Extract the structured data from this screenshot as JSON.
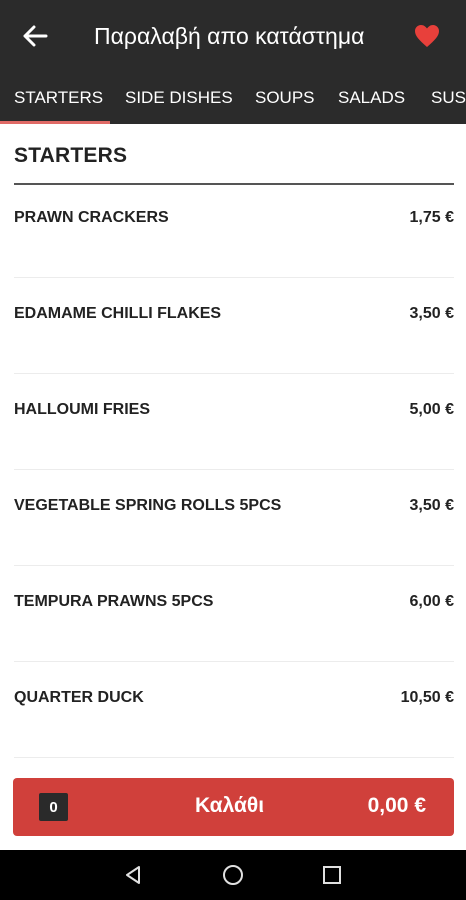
{
  "header": {
    "title": "Παραλαβή απο κατάστημα",
    "back_icon": "back-arrow-icon",
    "favorite_icon": "heart-icon",
    "favorite_color": "#e8403b"
  },
  "tabs": [
    {
      "label": "STARTERS",
      "active": true
    },
    {
      "label": "SIDE DISHES",
      "active": false
    },
    {
      "label": "SOUPS",
      "active": false
    },
    {
      "label": "SALADS",
      "active": false
    },
    {
      "label": "SUSHI",
      "active": false
    }
  ],
  "section": {
    "title": "STARTERS",
    "items": [
      {
        "name": "PRAWN CRACKERS",
        "price": "1,75 €"
      },
      {
        "name": "EDAMAME CHILLI FLAKES",
        "price": "3,50 €"
      },
      {
        "name": "HALLOUMI FRIES",
        "price": "5,00 €"
      },
      {
        "name": "VEGETABLE SPRING ROLLS 5PCS",
        "price": "3,50 €"
      },
      {
        "name": "TEMPURA PRAWNS 5PCS",
        "price": "6,00 €"
      },
      {
        "name": "QUARTER DUCK",
        "price": "10,50 €"
      }
    ]
  },
  "cart": {
    "count": "0",
    "label": "Καλάθι",
    "total": "0,00 €",
    "color": "#d0403b"
  },
  "system_nav": {
    "icons": [
      "back-triangle-icon",
      "home-circle-icon",
      "recents-square-icon"
    ]
  }
}
